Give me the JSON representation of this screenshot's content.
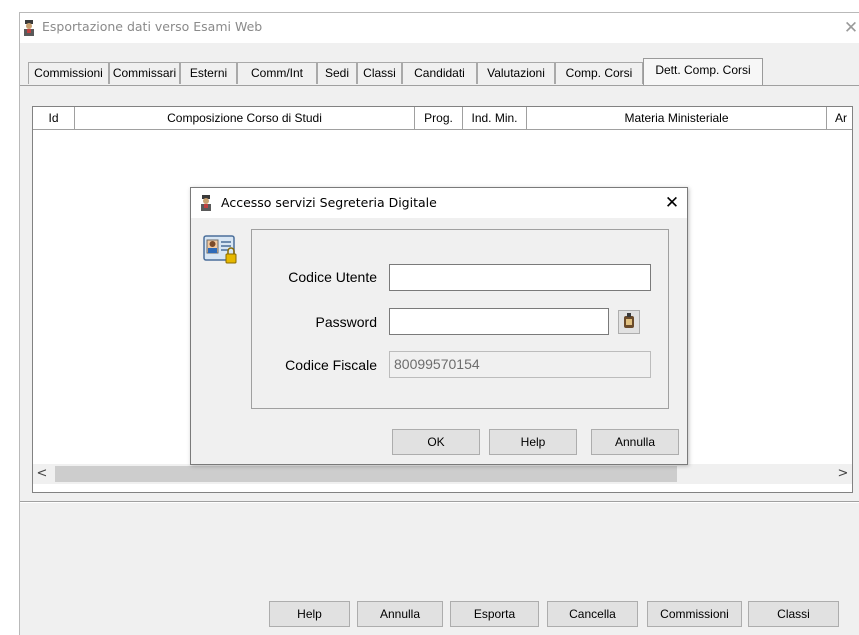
{
  "window": {
    "title": "Esportazione dati verso Esami Web",
    "close_glyph": "✕"
  },
  "tabs": [
    "Commissioni",
    "Commissari",
    "Esterni",
    "Comm/Int",
    "Sedi",
    "Classi",
    "Candidati",
    "Valutazioni",
    "Comp. Corsi",
    "Dett. Comp. Corsi"
  ],
  "active_tab": "Dett. Comp. Corsi",
  "grid": {
    "columns": [
      "Id",
      "Composizione Corso di Studi",
      "Prog.",
      "Ind. Min.",
      "Materia Ministeriale",
      "Ar"
    ],
    "scroll_left": "<",
    "scroll_right": ">"
  },
  "bottom_buttons": [
    "Help",
    "Annulla",
    "Esporta",
    "Cancella",
    "Commissioni",
    "Classi"
  ],
  "dialog": {
    "title": "Accesso servizi Segreteria Digitale",
    "close_glyph": "✕",
    "fields": {
      "user_label": "Codice Utente",
      "user_value": "",
      "password_label": "Password",
      "password_value": "",
      "fiscal_label": "Codice Fiscale",
      "fiscal_value": "80099570154"
    },
    "buttons": {
      "ok": "OK",
      "help": "Help",
      "cancel": "Annulla"
    }
  },
  "icons": {
    "app": "app-person-icon",
    "card": "id-card-lock-icon",
    "key": "key-icon"
  },
  "colors": {
    "window_bg": "#f0f0f0",
    "button_bg": "#e1e1e1",
    "border": "#adadad"
  }
}
